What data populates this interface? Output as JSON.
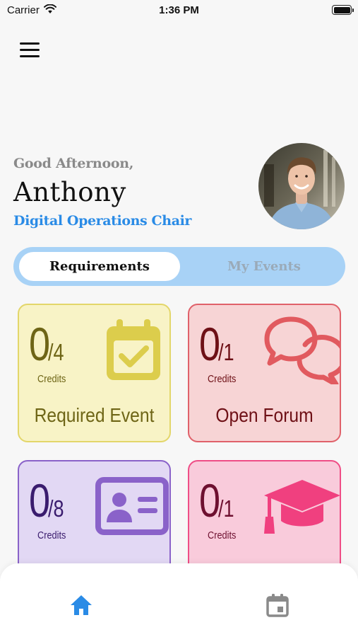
{
  "status_bar": {
    "carrier": "Carrier",
    "time": "1:36 PM"
  },
  "header": {
    "menu_icon": "hamburger-menu-icon"
  },
  "profile": {
    "greeting": "Good Afternoon,",
    "name": "Anthony",
    "role": "Digital Operations Chair",
    "accent_color": "#2a8be6"
  },
  "segmented_control": {
    "tabs": [
      {
        "label": "Requirements",
        "selected": true
      },
      {
        "label": "My Events",
        "selected": false
      }
    ]
  },
  "cards": [
    {
      "count": "0",
      "total": "/4",
      "credits_label": "Credits",
      "title": "Required Event",
      "icon": "calendar-check-icon",
      "color": "#e3d66a"
    },
    {
      "count": "0",
      "total": "/1",
      "credits_label": "Credits",
      "title": "Open Forum",
      "icon": "chat-bubbles-icon",
      "color": "#e0616a"
    },
    {
      "count": "0",
      "total": "/8",
      "credits_label": "Credits",
      "title": "",
      "icon": "id-card-icon",
      "color": "#8a62c9"
    },
    {
      "count": "0",
      "total": "/1",
      "credits_label": "Credits",
      "title": "",
      "icon": "graduation-cap-icon",
      "color": "#ef4d86"
    }
  ],
  "tab_bar": {
    "items": [
      {
        "icon": "home-icon",
        "active": true,
        "color": "#2a8be6"
      },
      {
        "icon": "calendar-icon",
        "active": false,
        "color": "#8a8a8a"
      }
    ]
  }
}
